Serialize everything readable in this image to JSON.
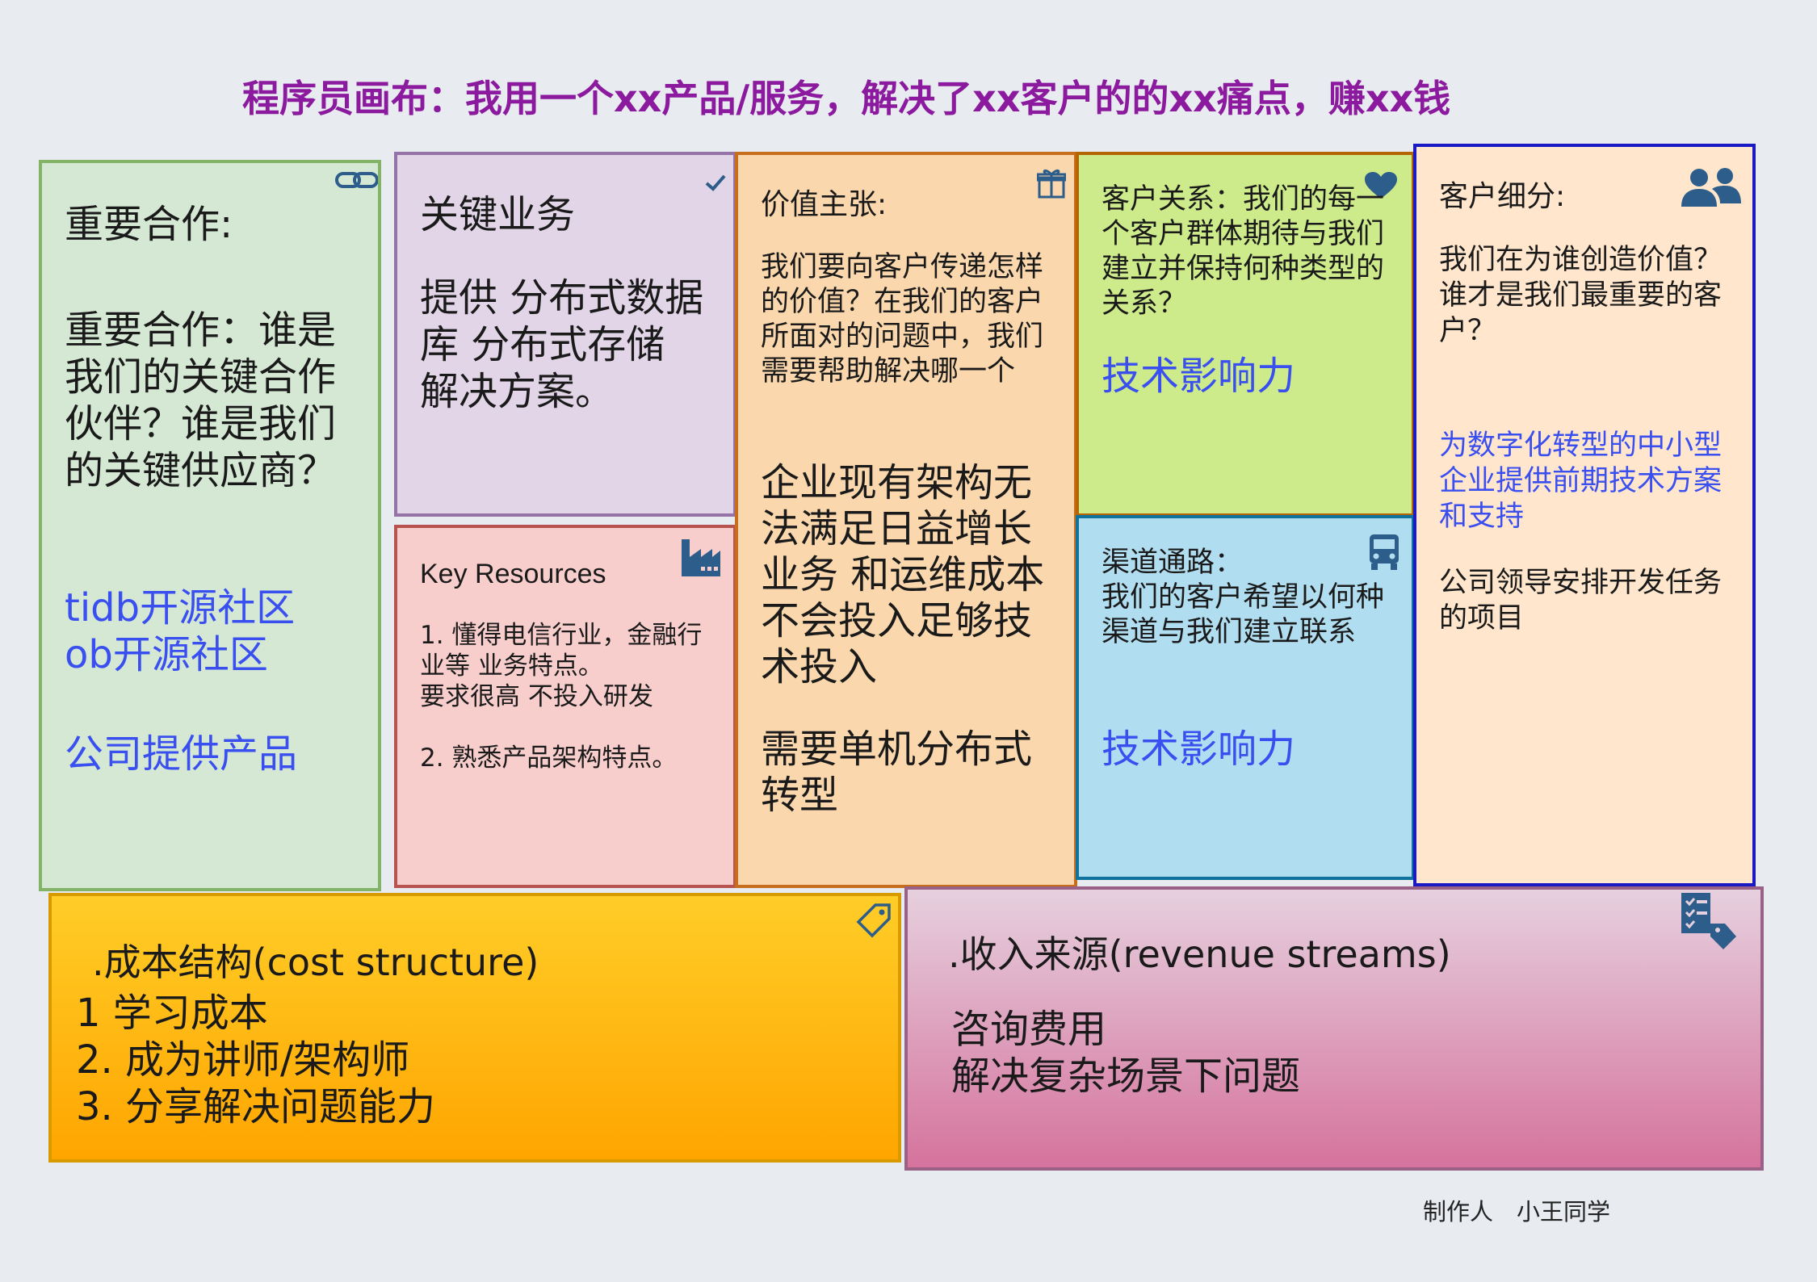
{
  "title": "程序员画布：我用一个xx产品/服务，解决了xx客户的的xx痛点，赚xx钱",
  "key_partners": {
    "heading": "重要合作:",
    "question": "重要合作：谁是\n我们的关键合作\n伙伴？谁是我们\n的关键供应商？",
    "items": "tidb开源社区\nob开源社区",
    "item2": "公司提供产品",
    "icon": "link-icon"
  },
  "key_activities": {
    "heading": "关键业务",
    "content": "提供 分布式数据\n库 分布式存储\n解决方案。",
    "icon": "check-icon"
  },
  "key_resources": {
    "heading": "Key Resources",
    "content": "1. 懂得电信行业，金融行\n业等 业务特点。\n要求很高 不投入研发\n\n2. 熟悉产品架构特点。",
    "icon": "factory-icon"
  },
  "value_propositions": {
    "heading": "价值主张:",
    "question": "我们要向客户传递怎样\n的价值？在我们的客户\n所面对的问题中，我们\n需要帮助解决哪一个",
    "content1": "企业现有架构无\n法满足日益增长\n业务 和运维成本\n不会投入足够技\n术投入",
    "content2": "需要单机分布式\n转型",
    "icon": "gift-icon"
  },
  "customer_relationships": {
    "question": "客户关系：我们的每一\n个客户群体期待与我们\n建立并保持何种类型的\n关系？",
    "answer": "技术影响力",
    "icon": "heart-icon"
  },
  "channels": {
    "question": "渠道通路：\n我们的客户希望以何种\n渠道与我们建立联系",
    "answer": "技术影响力",
    "icon": "truck-icon"
  },
  "customer_segments": {
    "heading": "客户细分:",
    "question": "我们在为谁创造价值？\n谁才是我们最重要的客\n户？",
    "answer": "为数字化转型的中小型\n企业提供前期技术方案\n和支持",
    "note": "公司领导安排开发任务\n的项目",
    "icon": "users-icon"
  },
  "cost_structure": {
    "heading": "成本结构(cost structure)",
    "content": "1 学习成本\n2. 成为讲师/架构师\n3. 分享解决问题能力",
    "icon": "tag-icon"
  },
  "revenue_streams": {
    "heading": "收入来源(revenue streams)",
    "content": "咨询费用\n解决复杂场景下问题",
    "icon": "price-list-icon"
  },
  "author": "制作人　小王同学",
  "colors": {
    "title": "#8b1a9e",
    "highlight_blue": "#3a4ff0",
    "icon_blue": "#2d5d8a"
  }
}
